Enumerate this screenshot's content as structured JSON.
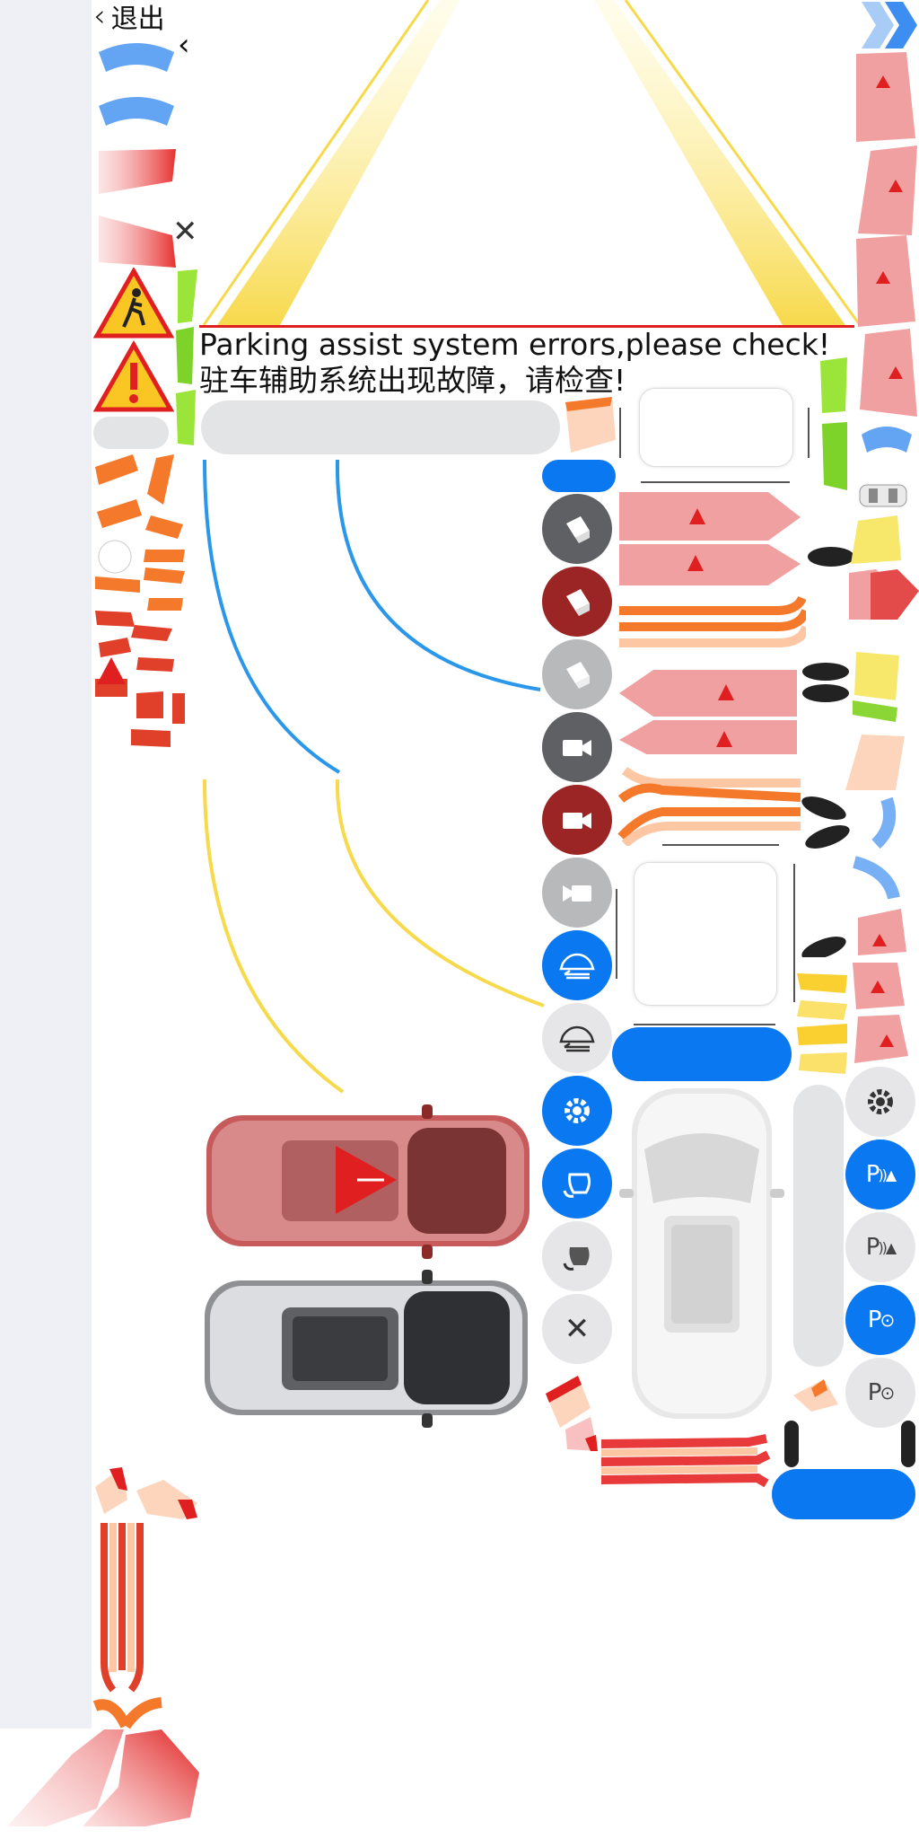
{
  "header": {
    "back_label": "退出"
  },
  "alert": {
    "title_en": "Parking assist system errors,please check!",
    "title_zh": "驻车辅助系统出现故障，请检查!"
  },
  "colors": {
    "accent_blue": "#0a78f0",
    "alert_red": "#e02020",
    "warn_pink": "#f0a0a0",
    "guide_yellow": "#f7d94c",
    "sidebar_bg": "#eef0f5"
  },
  "controls": {
    "left_column": [
      {
        "name": "camera-3d-dark-button",
        "icon": "cube-icon",
        "state": "normal"
      },
      {
        "name": "camera-3d-red-button",
        "icon": "cube-icon",
        "state": "error"
      },
      {
        "name": "camera-3d-disabled-button",
        "icon": "cube-icon",
        "state": "disabled"
      },
      {
        "name": "camera-dark-button",
        "icon": "video-camera-icon",
        "state": "normal"
      },
      {
        "name": "camera-red-button",
        "icon": "video-camera-icon",
        "state": "error"
      },
      {
        "name": "camera-disabled-button",
        "icon": "video-camera-icon",
        "state": "disabled"
      },
      {
        "name": "car-swap-active-button",
        "icon": "car-swap-icon",
        "state": "active"
      },
      {
        "name": "car-swap-button",
        "icon": "car-swap-icon",
        "state": "normal"
      },
      {
        "name": "settings-active-button",
        "icon": "gear-icon",
        "state": "active"
      },
      {
        "name": "mirror-active-button",
        "icon": "mirror-icon",
        "state": "active"
      },
      {
        "name": "mirror-button",
        "icon": "mirror-icon",
        "state": "normal"
      },
      {
        "name": "close-button",
        "icon": "close-icon",
        "state": "normal"
      }
    ],
    "right_column": [
      {
        "name": "settings-button",
        "icon": "gear-icon",
        "label": "",
        "state": "normal"
      },
      {
        "name": "park-sensor-active-button",
        "icon": "park-sensor-icon",
        "label": "P",
        "state": "active"
      },
      {
        "name": "park-sensor-button",
        "icon": "park-sensor-icon",
        "label": "P",
        "state": "normal"
      },
      {
        "name": "park-assist-active-button",
        "icon": "park-wheel-icon",
        "label": "P",
        "state": "active"
      },
      {
        "name": "park-assist-button",
        "icon": "park-wheel-icon",
        "label": "P",
        "state": "normal"
      }
    ]
  }
}
